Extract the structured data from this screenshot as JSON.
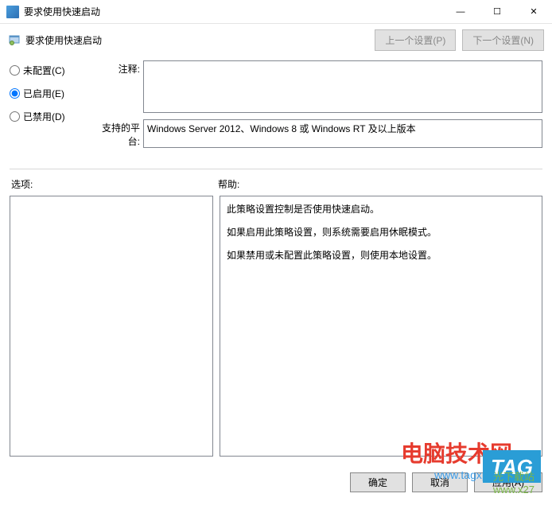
{
  "window": {
    "title": "要求使用快速启动"
  },
  "toolbar": {
    "title": "要求使用快速启动",
    "prev_button": "上一个设置(P)",
    "next_button": "下一个设置(N)"
  },
  "radios": {
    "not_configured": "未配置(C)",
    "enabled": "已启用(E)",
    "disabled": "已禁用(D)",
    "selected": "enabled"
  },
  "fields": {
    "comment_label": "注释:",
    "comment_value": "",
    "platform_label": "支持的平台:",
    "platform_value": "Windows Server 2012、Windows 8 或 Windows RT 及以上版本"
  },
  "sections": {
    "options_label": "选项:",
    "help_label": "帮助:"
  },
  "help": {
    "p1": "此策略设置控制是否使用快速启动。",
    "p2": "如果启用此策略设置，则系统需要启用休眠模式。",
    "p3": "如果禁用或未配置此策略设置，则使用本地设置。"
  },
  "buttons": {
    "ok": "确定",
    "cancel": "取消",
    "apply": "应用(A)"
  },
  "watermark": {
    "line1": "电脑技术网",
    "line2": "www.tagxp.com",
    "badge": "TAG",
    "site": "光下载站",
    "url": "www.x27"
  }
}
